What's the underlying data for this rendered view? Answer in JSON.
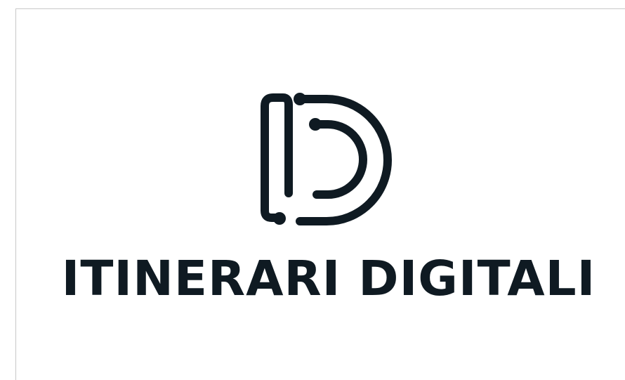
{
  "logo": {
    "brand_name": "ITINERARI DIGITALI",
    "mark_icon": "letter-d-monogram-icon"
  },
  "colors": {
    "ink": "#0f1a22",
    "background": "#ffffff",
    "frame": "#c8c8c8"
  }
}
